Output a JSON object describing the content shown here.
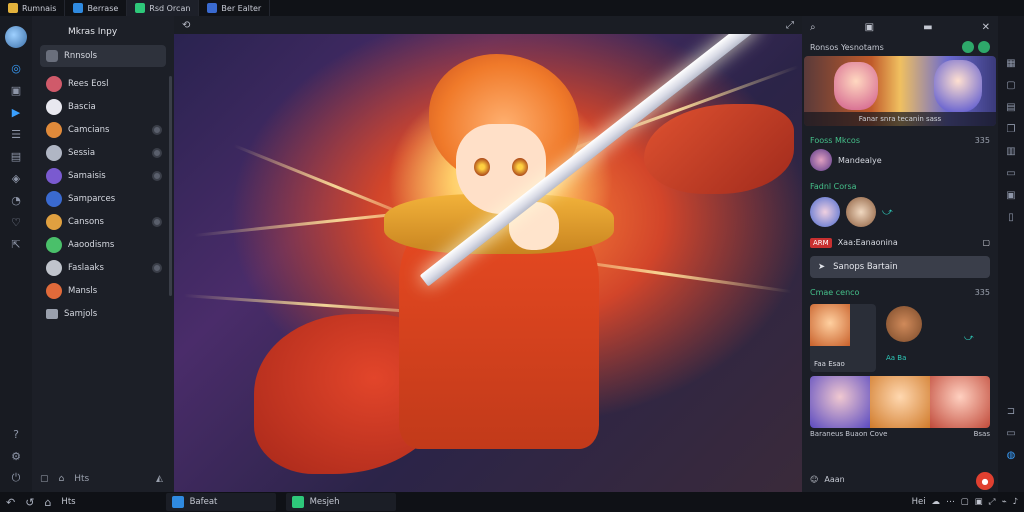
{
  "tabs": [
    {
      "label": "Rumnais",
      "color": "#e3b23c"
    },
    {
      "label": "Berrase",
      "color": "#2f8ae0"
    },
    {
      "label": "Rsd Orcan",
      "color": "#2ec87a"
    },
    {
      "label": "Ber Ealter",
      "color": "#3a6ad0"
    }
  ],
  "sidebar": {
    "title": "Mkras Inpy",
    "items": [
      {
        "label": "Rnnsols",
        "color": "#6a6f7c"
      },
      {
        "label": "Rees Eosl",
        "color": "#d05a6a"
      },
      {
        "label": "Bascia",
        "color": "#e8e8ef"
      },
      {
        "label": "Camcians",
        "color": "#e08a3a"
      },
      {
        "label": "Sessia",
        "color": "#b0b6c4"
      },
      {
        "label": "Samaisis",
        "color": "#7a5ad0"
      },
      {
        "label": "Samparces",
        "color": "#3a6ad0"
      },
      {
        "label": "Cansons",
        "color": "#e0a040"
      },
      {
        "label": "Aaoodisms",
        "color": "#4ac06a"
      },
      {
        "label": "Faslaaks",
        "color": "#c0c4cc"
      },
      {
        "label": "Mansls",
        "color": "#e06a3a"
      },
      {
        "label": "Samjols",
        "color": "#9aa0ad"
      }
    ],
    "footer_label": "Hts"
  },
  "right_panel": {
    "subtitle": "Ronsos Yesnotams",
    "hero_caption": "Fanar snra tecanin sass",
    "section1": {
      "title": "Fooss Mkcos",
      "count": "335"
    },
    "row1": {
      "label": "Mandealye"
    },
    "section2": {
      "title": "Fadnl Corsa"
    },
    "tag": {
      "label": "ARM",
      "text": "Xaa:Eanaonina"
    },
    "wide_button": "Sanops Bartain",
    "section3": {
      "title": "Cmae cenco",
      "count": "335"
    },
    "card_label": "Faa Esao",
    "card2_label": "Aa Ba",
    "strip_caption_left": "Baraneus Buaon Cove",
    "strip_caption_right": "Bsas",
    "footer_label": "Aaan"
  },
  "taskbar": {
    "label": "Hts",
    "apps": [
      {
        "label": "Bafeat",
        "color": "#2f8ae0"
      },
      {
        "label": "Mesjeh",
        "color": "#2ec87a"
      }
    ],
    "tray_label": "Hei"
  }
}
